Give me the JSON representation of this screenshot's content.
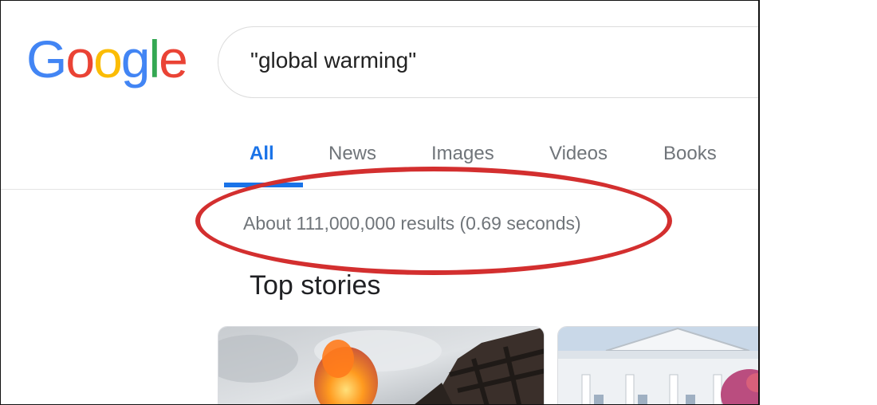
{
  "logo": {
    "letters": [
      "G",
      "o",
      "o",
      "g",
      "l",
      "e"
    ],
    "colors": [
      "#4285F4",
      "#EA4335",
      "#FBBC05",
      "#4285F4",
      "#34A853",
      "#EA4335"
    ]
  },
  "search": {
    "query": "\"global warming\""
  },
  "tabs": [
    {
      "label": "All",
      "active": true
    },
    {
      "label": "News",
      "active": false
    },
    {
      "label": "Images",
      "active": false
    },
    {
      "label": "Videos",
      "active": false
    },
    {
      "label": "Books",
      "active": false
    }
  ],
  "results": {
    "stats": "About 111,000,000 results (0.69 seconds)"
  },
  "top_stories": {
    "title": "Top stories"
  },
  "colors": {
    "accent": "#1a73e8",
    "annotation": "#d32f2f",
    "muted_text": "#70757a"
  }
}
